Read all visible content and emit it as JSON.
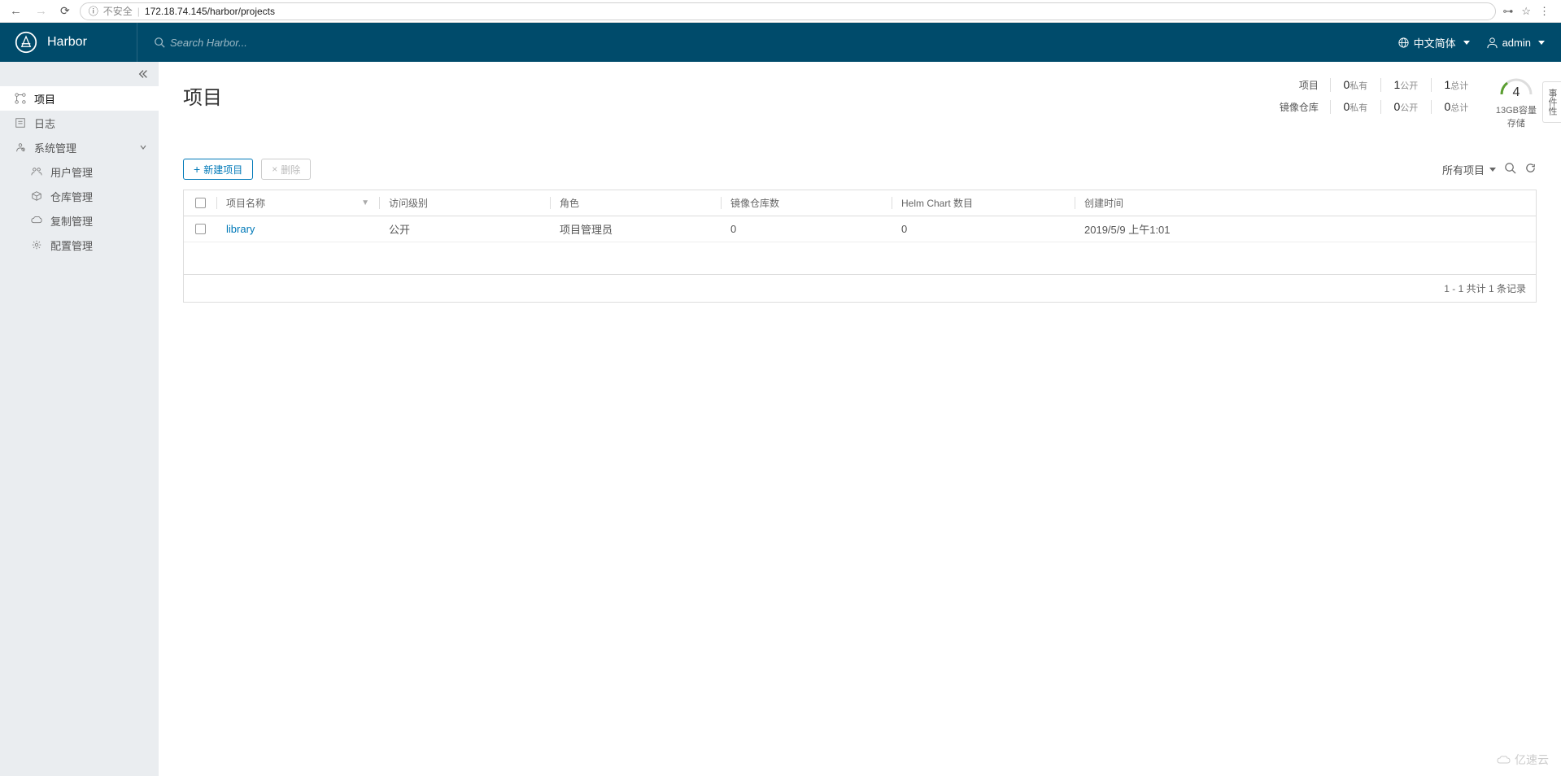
{
  "browser": {
    "security_label": "不安全",
    "url": "172.18.74.145/harbor/projects"
  },
  "header": {
    "app_name": "Harbor",
    "search_placeholder": "Search Harbor...",
    "language": "中文简体",
    "user": "admin"
  },
  "sidebar": {
    "items": [
      {
        "label": "项目"
      },
      {
        "label": "日志"
      },
      {
        "label": "系统管理"
      },
      {
        "label": "用户管理"
      },
      {
        "label": "仓库管理"
      },
      {
        "label": "复制管理"
      },
      {
        "label": "配置管理"
      }
    ]
  },
  "page": {
    "title": "项目",
    "stats": {
      "row1_label": "项目",
      "row2_label": "镜像仓库",
      "private_label": "私有",
      "public_label": "公开",
      "total_label": "总计",
      "projects_private": "0",
      "projects_public": "1",
      "projects_total": "1",
      "repos_private": "0",
      "repos_public": "0",
      "repos_total": "0",
      "gauge_value": "4",
      "capacity": "13GB容量",
      "storage": "存储"
    },
    "toolbar": {
      "new_project": "新建项目",
      "delete": "删除",
      "filter": "所有项目"
    },
    "table": {
      "headers": {
        "name": "项目名称",
        "access": "访问级别",
        "role": "角色",
        "repo_count": "镜像仓库数",
        "helm_count": "Helm Chart 数目",
        "created": "创建时间"
      },
      "rows": [
        {
          "name": "library",
          "access": "公开",
          "role": "项目管理员",
          "repo_count": "0",
          "helm_count": "0",
          "created": "2019/5/9 上午1:01"
        }
      ],
      "footer": "1 - 1 共计 1 条记录"
    }
  },
  "side_tab": "事件性",
  "watermark": "亿速云"
}
